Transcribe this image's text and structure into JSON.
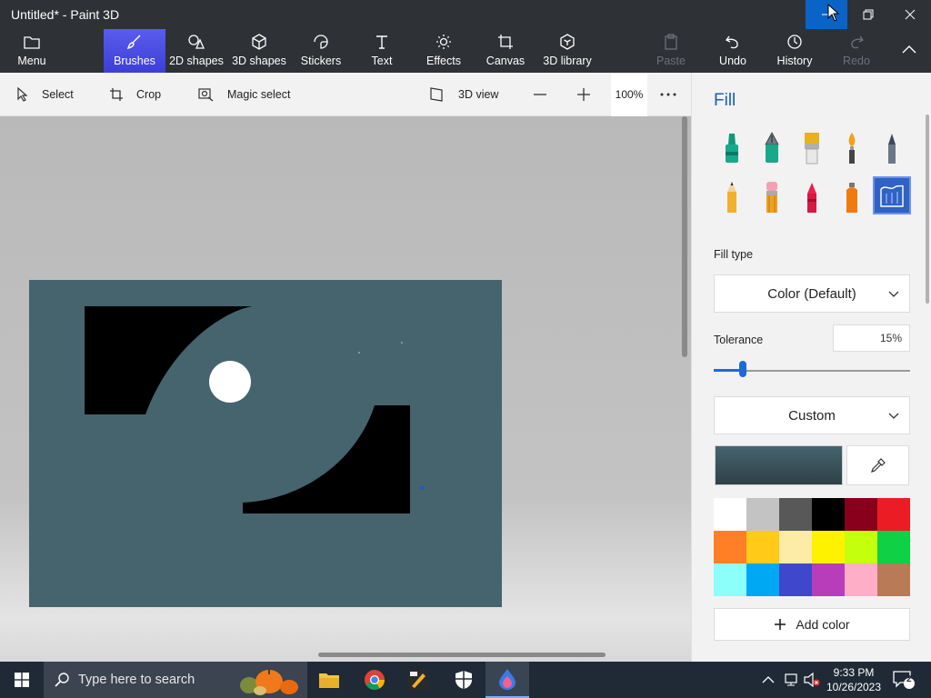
{
  "window": {
    "title": "Untitled* - Paint 3D"
  },
  "ribbon": {
    "tabs": [
      {
        "label": "Menu",
        "icon": "folder-icon"
      },
      {
        "label": "Brushes",
        "icon": "brush-icon",
        "active": true
      },
      {
        "label": "2D shapes",
        "icon": "shapes-2d-icon"
      },
      {
        "label": "3D shapes",
        "icon": "cube-icon"
      },
      {
        "label": "Stickers",
        "icon": "sticker-icon"
      },
      {
        "label": "Text",
        "icon": "text-icon"
      },
      {
        "label": "Effects",
        "icon": "sun-icon"
      },
      {
        "label": "Canvas",
        "icon": "canvas-icon"
      },
      {
        "label": "3D library",
        "icon": "library-icon"
      }
    ],
    "actions": [
      {
        "label": "Paste",
        "icon": "paste-icon",
        "disabled": true
      },
      {
        "label": "Undo",
        "icon": "undo-icon"
      },
      {
        "label": "History",
        "icon": "history-icon"
      },
      {
        "label": "Redo",
        "icon": "redo-icon",
        "disabled": true
      }
    ]
  },
  "toolbar": {
    "select": "Select",
    "crop": "Crop",
    "magic_select": "Magic select",
    "view_3d": "3D view",
    "zoom": "100%"
  },
  "panel": {
    "title": "Fill",
    "brushes": [
      "marker",
      "calligraphy-pen",
      "oil-brush",
      "watercolor",
      "pixel-pen",
      "pencil",
      "eraser",
      "crayon",
      "spray-can",
      "fill"
    ],
    "selected_brush": "fill",
    "fill_type_label": "Fill type",
    "fill_type_value": "Color (Default)",
    "tolerance_label": "Tolerance",
    "tolerance_value": "15%",
    "tolerance_level": 0.15,
    "color_mode": "Custom",
    "current_color": "#46646e",
    "palette": [
      "#ffffff",
      "#c3c3c3",
      "#585858",
      "#000000",
      "#88001b",
      "#ec1c24",
      "#ff7f27",
      "#ffca18",
      "#fdeca6",
      "#fff200",
      "#c4ff0e",
      "#0ed145",
      "#8cfffb",
      "#00a8f3",
      "#3f48cc",
      "#b83dba",
      "#ffaec8",
      "#b97a56"
    ],
    "add_color": "Add color"
  },
  "taskbar": {
    "search_placeholder": "Type here to search",
    "time": "9:33 PM",
    "date": "10/26/2023",
    "notifications": "2"
  }
}
